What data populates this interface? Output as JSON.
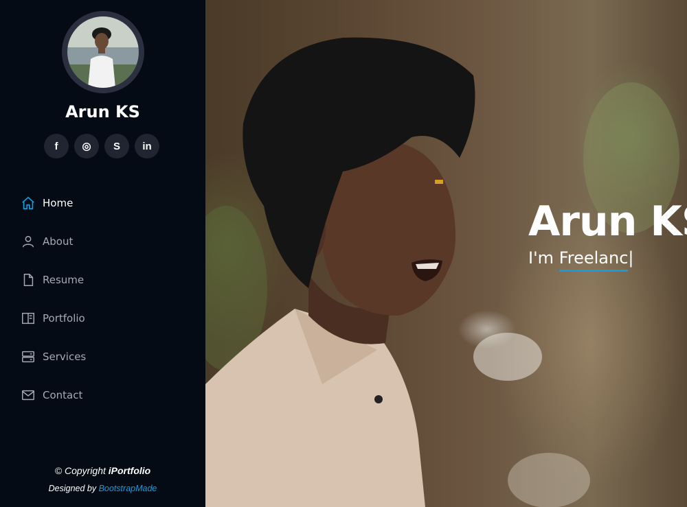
{
  "profile": {
    "name": "Arun KS"
  },
  "social": [
    {
      "icon": "facebook-icon",
      "glyph": "f"
    },
    {
      "icon": "instagram-icon",
      "glyph": "◎"
    },
    {
      "icon": "skype-icon",
      "glyph": "S"
    },
    {
      "icon": "linkedin-icon",
      "glyph": "in"
    }
  ],
  "nav": {
    "home": "Home",
    "about": "About",
    "resume": "Resume",
    "portfolio": "Portfolio",
    "services": "Services",
    "contact": "Contact"
  },
  "footer": {
    "copyright_prefix": "© Copyright ",
    "brand": "iPortfolio",
    "designed_prefix": "Designed by ",
    "designer": "BootstrapMade"
  },
  "hero": {
    "title": "Arun KS",
    "prefix": "I'm ",
    "typed": "Freelanc",
    "cursor": "|"
  },
  "colors": {
    "accent": "#149ddd",
    "sidebar": "#040b14",
    "nav_text": "#a8a9b4"
  }
}
